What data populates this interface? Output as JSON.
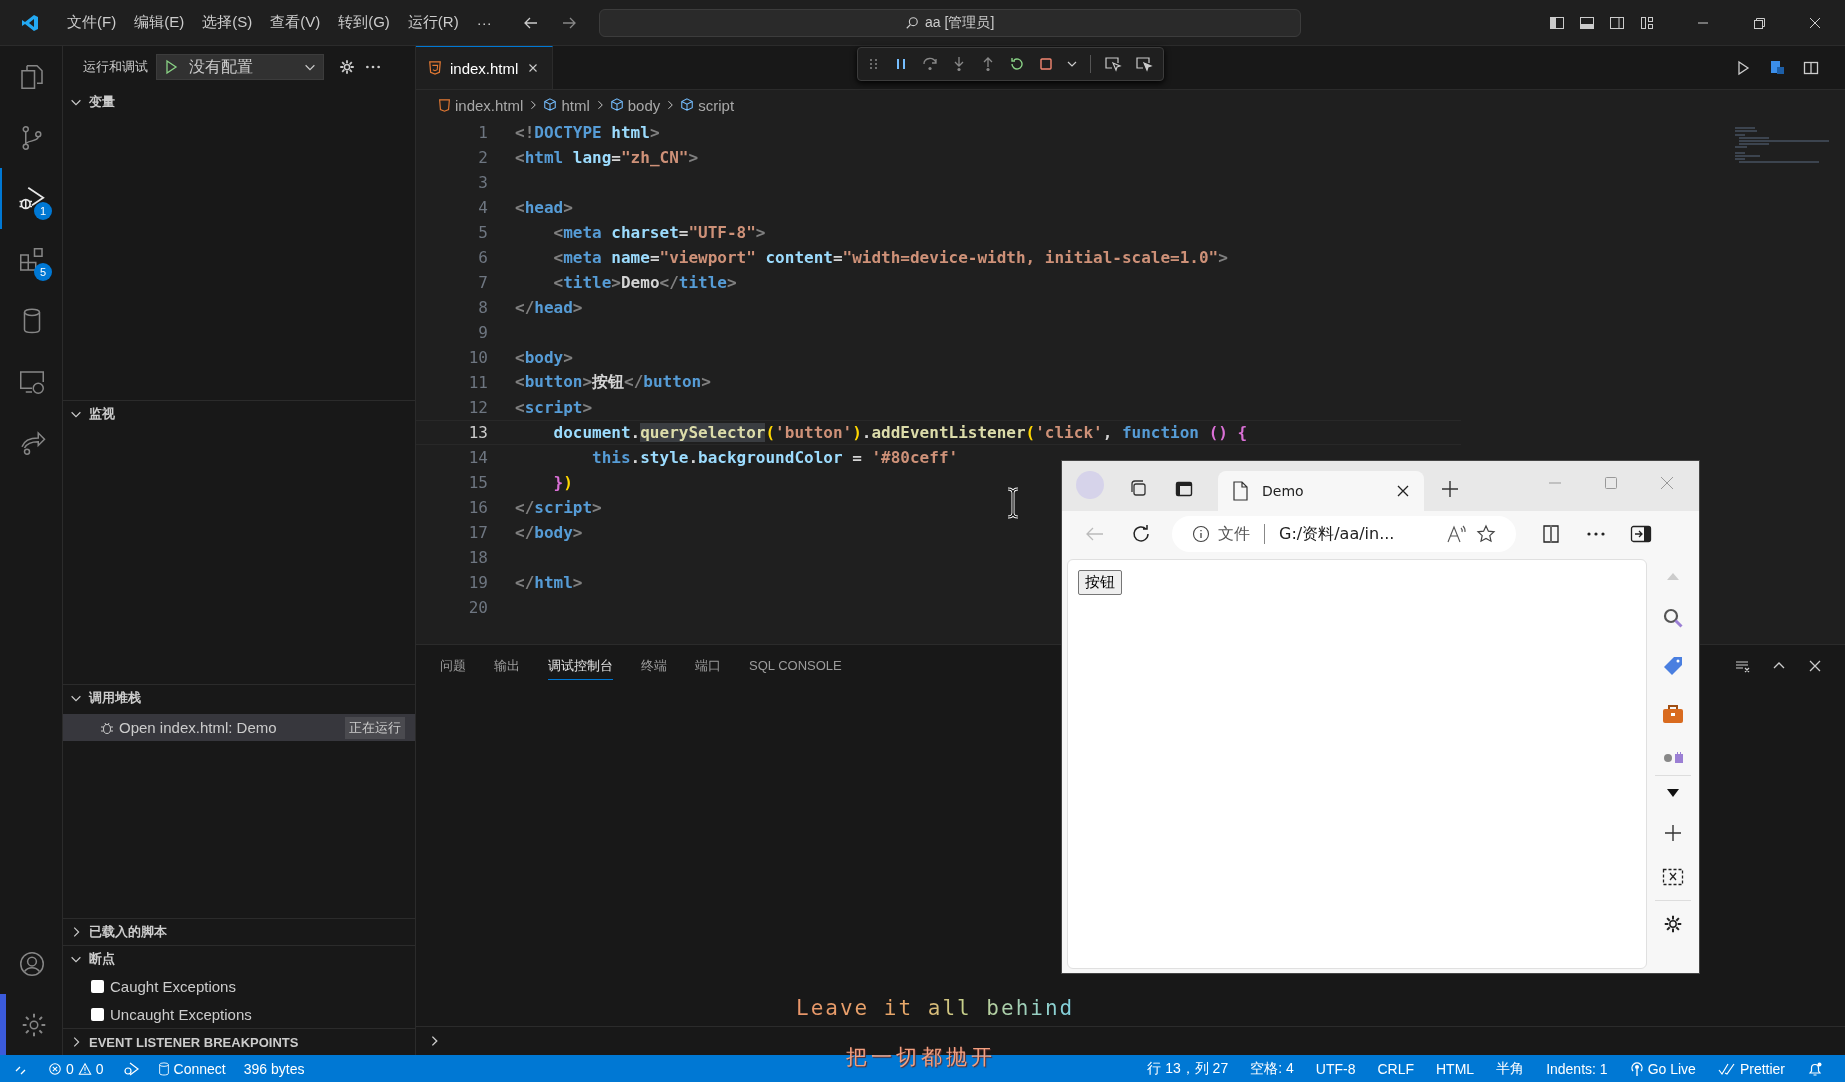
{
  "title_bar": {
    "menus": [
      "文件(F)",
      "编辑(E)",
      "选择(S)",
      "查看(V)",
      "转到(G)",
      "运行(R)",
      "···"
    ],
    "search": "aa [管理员]"
  },
  "activity_bar": {
    "items": [
      {
        "selected": false
      },
      {
        "selected": false
      },
      {
        "selected": true,
        "badge": "1"
      },
      {
        "selected": false,
        "badge": "5"
      },
      {
        "selected": false
      },
      {
        "selected": false
      },
      {
        "selected": false
      }
    ]
  },
  "sidebar": {
    "title": "运行和调试",
    "config": "没有配置",
    "sections": [
      {
        "title": "变量",
        "kind": "empty",
        "expanded": true
      },
      {
        "title": "监视",
        "kind": "empty",
        "expanded": true
      },
      {
        "title": "调用堆栈",
        "kind": "callstack",
        "expanded": true,
        "items": [
          {
            "label": "Open index.html: Demo",
            "status": "正在运行"
          }
        ]
      },
      {
        "title": "已载入的脚本",
        "expanded": false
      },
      {
        "title": "断点",
        "kind": "breakpoints",
        "expanded": true,
        "items": [
          {
            "label": "Caught Exceptions",
            "checked": false
          },
          {
            "label": "Uncaught Exceptions",
            "checked": false
          }
        ]
      },
      {
        "title": "EVENT LISTENER BREAKPOINTS",
        "expanded": false
      }
    ]
  },
  "editor": {
    "tabs": [
      {
        "label": "index.html",
        "selected": true
      }
    ],
    "breadcrumbs": [
      "index.html",
      "html",
      "body",
      "script"
    ],
    "lines": [
      {
        "number": "1",
        "current": false,
        "tokens": [
          {
            "kind": "p",
            "text": "<!"
          },
          {
            "kind": "tag",
            "text": "DOCTYPE"
          },
          {
            "kind": "attr",
            "text": " html"
          },
          {
            "kind": "p",
            "text": ">"
          }
        ]
      },
      {
        "number": "2",
        "current": false,
        "tokens": [
          {
            "kind": "p",
            "text": "<"
          },
          {
            "kind": "tag",
            "text": "html"
          },
          {
            "kind": "attr",
            "text": " lang"
          },
          {
            "kind": "t",
            "text": "="
          },
          {
            "kind": "str",
            "text": "\"zh_CN\""
          },
          {
            "kind": "p",
            "text": ">"
          }
        ]
      },
      {
        "number": "3",
        "current": false
      },
      {
        "number": "4",
        "current": false,
        "tokens": [
          {
            "kind": "p",
            "text": "<"
          },
          {
            "kind": "tag",
            "text": "head"
          },
          {
            "kind": "p",
            "text": ">"
          }
        ]
      },
      {
        "number": "5",
        "current": false,
        "tokens": [
          {
            "kind": "p",
            "text": "    <"
          },
          {
            "kind": "tag",
            "text": "meta"
          },
          {
            "kind": "attr",
            "text": " charset"
          },
          {
            "kind": "t",
            "text": "="
          },
          {
            "kind": "str",
            "text": "\"UTF-8\""
          },
          {
            "kind": "p",
            "text": ">"
          }
        ]
      },
      {
        "number": "6",
        "current": false,
        "tokens": [
          {
            "kind": "p",
            "text": "    <"
          },
          {
            "kind": "tag",
            "text": "meta"
          },
          {
            "kind": "attr",
            "text": " name"
          },
          {
            "kind": "t",
            "text": "="
          },
          {
            "kind": "str",
            "text": "\"viewport\""
          },
          {
            "kind": "attr",
            "text": " content"
          },
          {
            "kind": "t",
            "text": "="
          },
          {
            "kind": "str",
            "text": "\"width=device-width, initial-scale=1.0\""
          },
          {
            "kind": "p",
            "text": ">"
          }
        ]
      },
      {
        "number": "7",
        "current": false,
        "tokens": [
          {
            "kind": "p",
            "text": "    <"
          },
          {
            "kind": "tag",
            "text": "title"
          },
          {
            "kind": "p",
            "text": ">"
          },
          {
            "kind": "t",
            "text": "Demo"
          },
          {
            "kind": "p",
            "text": "</"
          },
          {
            "kind": "tag",
            "text": "title"
          },
          {
            "kind": "p",
            "text": ">"
          }
        ]
      },
      {
        "number": "8",
        "current": false,
        "tokens": [
          {
            "kind": "p",
            "text": "</"
          },
          {
            "kind": "tag",
            "text": "head"
          },
          {
            "kind": "p",
            "text": ">"
          }
        ]
      },
      {
        "number": "9",
        "current": false
      },
      {
        "number": "10",
        "current": false,
        "tokens": [
          {
            "kind": "p",
            "text": "<"
          },
          {
            "kind": "tag",
            "text": "body"
          },
          {
            "kind": "p",
            "text": ">"
          }
        ]
      },
      {
        "number": "11",
        "current": false,
        "tokens": [
          {
            "kind": "p",
            "text": "<"
          },
          {
            "kind": "tag",
            "text": "button"
          },
          {
            "kind": "p",
            "text": ">"
          },
          {
            "kind": "t",
            "text": "按钮"
          },
          {
            "kind": "p",
            "text": "</"
          },
          {
            "kind": "tag",
            "text": "button"
          },
          {
            "kind": "p",
            "text": ">"
          }
        ]
      },
      {
        "number": "12",
        "current": false,
        "tokens": [
          {
            "kind": "p",
            "text": "<"
          },
          {
            "kind": "tag",
            "text": "script"
          },
          {
            "kind": "p",
            "text": ">"
          }
        ]
      },
      {
        "number": "13",
        "current": true,
        "tokens": [
          {
            "kind": "var",
            "text": "    document"
          },
          {
            "kind": "t",
            "text": "."
          },
          {
            "kind": "hl",
            "text": "querySelector"
          },
          {
            "kind": "b1",
            "text": "("
          },
          {
            "kind": "str",
            "text": "'button'"
          },
          {
            "kind": "b1",
            "text": ")"
          },
          {
            "kind": "t",
            "text": "."
          },
          {
            "kind": "fn",
            "text": "addEventListener"
          },
          {
            "kind": "b1",
            "text": "("
          },
          {
            "kind": "str",
            "text": "'click'"
          },
          {
            "kind": "t",
            "text": ","
          },
          {
            "kind": "kw",
            "text": " function"
          },
          {
            "kind": "b2",
            "text": " ()"
          },
          {
            "kind": "b2",
            "text": " {"
          }
        ]
      },
      {
        "number": "14",
        "current": false,
        "tokens": [
          {
            "kind": "kw",
            "text": "        this"
          },
          {
            "kind": "t",
            "text": "."
          },
          {
            "kind": "var",
            "text": "style"
          },
          {
            "kind": "t",
            "text": "."
          },
          {
            "kind": "var",
            "text": "backgroundColor"
          },
          {
            "kind": "t",
            "text": " ="
          },
          {
            "kind": "str",
            "text": " '#80ceff'"
          }
        ]
      },
      {
        "number": "15",
        "current": false,
        "tokens": [
          {
            "kind": "b2",
            "text": "    }"
          },
          {
            "kind": "b1",
            "text": ")"
          }
        ]
      },
      {
        "number": "16",
        "current": false,
        "tokens": [
          {
            "kind": "p",
            "text": "</"
          },
          {
            "kind": "tag",
            "text": "script"
          },
          {
            "kind": "p",
            "text": ">"
          }
        ]
      },
      {
        "number": "17",
        "current": false,
        "tokens": [
          {
            "kind": "p",
            "text": "</"
          },
          {
            "kind": "tag",
            "text": "body"
          },
          {
            "kind": "p",
            "text": ">"
          }
        ]
      },
      {
        "number": "18",
        "current": false
      },
      {
        "number": "19",
        "current": false,
        "tokens": [
          {
            "kind": "p",
            "text": "</"
          },
          {
            "kind": "tag",
            "text": "html"
          },
          {
            "kind": "p",
            "text": ">"
          }
        ]
      },
      {
        "number": "20",
        "current": false
      }
    ]
  },
  "panel": {
    "tabs": [
      {
        "label": "问题",
        "selected": false
      },
      {
        "label": "输出",
        "selected": false
      },
      {
        "label": "调试控制台",
        "selected": true
      },
      {
        "label": "终端",
        "selected": false
      },
      {
        "label": "端口",
        "selected": false
      },
      {
        "label": "SQL CONSOLE",
        "selected": false
      }
    ]
  },
  "browser": {
    "tab": "Demo",
    "address_label": "文件",
    "url": "G:/资料/aa/in...",
    "page_button": "按钮"
  },
  "lyrics": [
    "Leave it all behind",
    "把一切都抛开"
  ],
  "status_bar": {
    "errors": "0",
    "warnings": "0",
    "connect": "Connect",
    "size": "396 bytes",
    "position": "行 13，列 27",
    "spaces": "空格: 4",
    "encoding": "UTF-8",
    "eol": "CRLF",
    "language": "HTML",
    "width": "半角",
    "indents": "Indents: 1",
    "go_live": "Go Live",
    "prettier": "Prettier"
  }
}
